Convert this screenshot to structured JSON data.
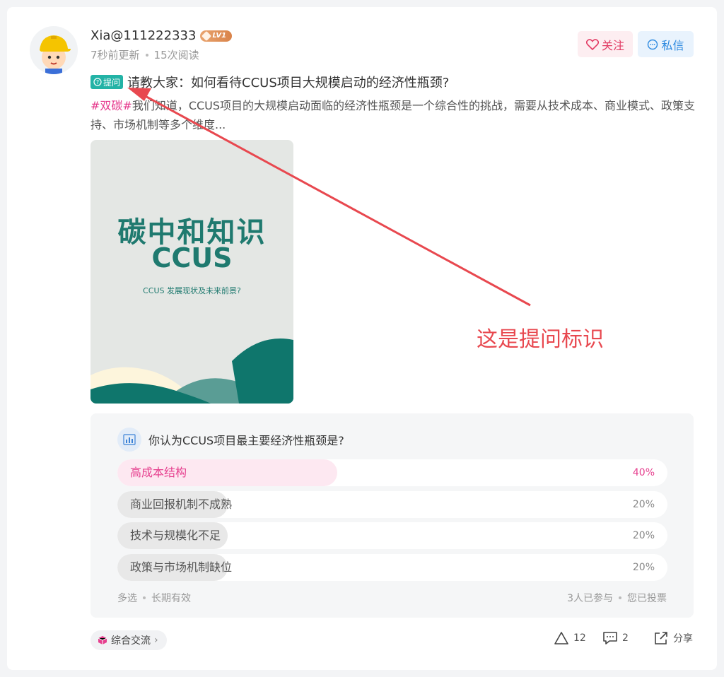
{
  "post": {
    "username": "Xia@111222333",
    "level": "LV1",
    "time": "7秒前更新",
    "reads": "15次阅读",
    "follow_label": "关注",
    "message_label": "私信",
    "question_tag": "提问",
    "title": "请教大家：如何看待CCUS项目大规模启动的经济性瓶颈?",
    "hashtag": "#双碳#",
    "excerpt": "我们知道，CCUS项目的大规模启动面临的经济性瓶颈是一个综合性的挑战，需要从技术成本、商业模式、政策支持、市场机制等多个维度..."
  },
  "cover": {
    "line1": "碳中和知识",
    "line2": "CCUS",
    "line3": "CCUS 发展现状及未来前景?"
  },
  "poll": {
    "question": "你认为CCUS项目最主要经济性瓶颈是?",
    "options": [
      {
        "label": "高成本结构",
        "percent_text": "40%",
        "percent": 40
      },
      {
        "label": "商业回报机制不成熟",
        "percent_text": "20%",
        "percent": 20
      },
      {
        "label": "技术与规模化不足",
        "percent_text": "20%",
        "percent": 20
      },
      {
        "label": "政策与市场机制缺位",
        "percent_text": "20%",
        "percent": 20
      }
    ],
    "mode": "多选",
    "validity": "长期有效",
    "participants": "3人已参与",
    "voted": "您已投票"
  },
  "footer": {
    "topic": "综合交流",
    "likes": "12",
    "comments": "2",
    "share": "分享"
  },
  "annotation": {
    "text": "这是提问标识"
  },
  "colors": {
    "accent_pink": "#e6408f",
    "annotation_red": "#e8484f",
    "tag_teal": "#23b3a6"
  }
}
